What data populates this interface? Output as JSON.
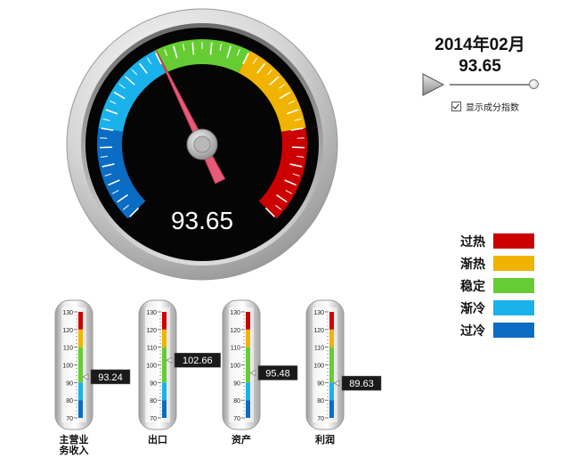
{
  "colors": {
    "overheat": "#cc0000",
    "warming": "#f0b400",
    "stable": "#66cc33",
    "cooling": "#1ab2ea",
    "overcool": "#0b6cc4"
  },
  "gauge": {
    "value": 93.65,
    "display_value": "93.65",
    "zones": [
      "overcool",
      "cooling",
      "stable",
      "warming",
      "overheat"
    ]
  },
  "period": {
    "date_label": "2014年02月",
    "value_label": "93.65"
  },
  "timeline": {
    "play_icon": "play-triangle-icon",
    "position_fraction": 1.0
  },
  "show_component_index": {
    "label": "显示成分指数",
    "checked": true
  },
  "legend": [
    {
      "label": "过热",
      "color_key": "overheat"
    },
    {
      "label": "渐热",
      "color_key": "warming"
    },
    {
      "label": "稳定",
      "color_key": "stable"
    },
    {
      "label": "渐冷",
      "color_key": "cooling"
    },
    {
      "label": "过冷",
      "color_key": "overcool"
    }
  ],
  "thermometers": {
    "ticks": [
      "130",
      "120",
      "110",
      "100",
      "90",
      "80",
      "70"
    ],
    "scale_min": 70,
    "scale_max": 130,
    "items": [
      {
        "label_lines": [
          "主营业",
          "务收入"
        ],
        "value": 93.24,
        "value_text": "93.24"
      },
      {
        "label_lines": [
          "出口"
        ],
        "value": 102.66,
        "value_text": "102.66"
      },
      {
        "label_lines": [
          "资产"
        ],
        "value": 95.48,
        "value_text": "95.48"
      },
      {
        "label_lines": [
          "利润"
        ],
        "value": 89.63,
        "value_text": "89.63"
      }
    ]
  }
}
